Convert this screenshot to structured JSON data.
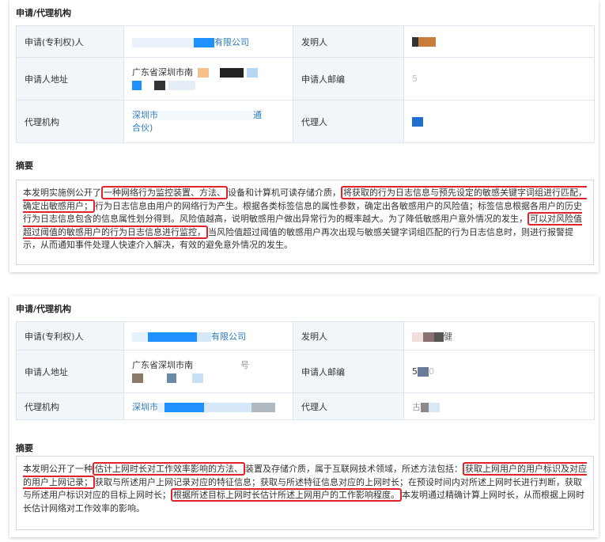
{
  "records": [
    {
      "section_title": "申请/代理机构",
      "rows": [
        {
          "label1": "申请(专利权)人",
          "value1": "有限公司",
          "label2": "发明人"
        },
        {
          "label1": "申请人地址",
          "value1": "广东省深圳市南",
          "label2": "申请人邮编",
          "value2": "5"
        },
        {
          "label1": "代理机构",
          "value1a": "深圳市",
          "value1b": "通",
          "value1c": "合伙)",
          "label2": "代理人"
        }
      ],
      "abstract_title": "摘要",
      "abstract": {
        "t1": "本发明实施例公开了",
        "h1": "一种网络行为监控装置、方法、",
        "t2": "设备和计算机可读存储介质，",
        "h2": "将获取的行为日志信息与预先设定的敏感关键字词组进行匹配，确定出敏感用户；",
        "t3": "行为日志信息由用户的网络行为产生。根据各类标签信息的属性参数，确定出各敏感用户的风险值；标签信息根据各用户的历史行为日志信息包含的信息属性划分得到。风险值越高，说明敏感用户做出异常行为的概率越大。为了降低敏感用户意外情况的发生，",
        "h3": "可以对风险值超过阈值的敏感用户的行为日志信息进行监控，",
        "t4": "当风险值超过阈值的敏感用户再次出现与敏感关键字词组匹配的行为日志信息时，则进行报警提示，从而通知事件处理人快速介入解决，有效的避免意外情况的发生。"
      }
    },
    {
      "section_title": "申请/代理机构",
      "rows": [
        {
          "label1": "申请(专利权)人",
          "value1": "有限公司",
          "label2": "发明人",
          "value2": "健"
        },
        {
          "label1": "申请人地址",
          "value1": "广东省深圳市南",
          "value1b": "号",
          "label2": "申请人邮编",
          "value2": "5",
          "value2b": "0"
        },
        {
          "label1": "代理机构",
          "value1a": "深圳市",
          "label2": "代理人",
          "value2": "古"
        }
      ],
      "abstract_title": "摘要",
      "abstract": {
        "t1": "本发明公开了一种",
        "h1": "估计上网时长对工作效率影响的方法、",
        "t2": "装置及存储介质，属于互联网技术领域，所述方法包括：",
        "h2": "获取上网用户的用户标识及对应的用户上网记录；",
        "t3": "获取与所述用户上网记录对应的特征信息；获取与所述特征信息对应的上网时长；在预设时间内对所述上网时长进行判断，获取与所述用户标识对应的目标上网时长；",
        "h3": "根据所述目标上网时长估计所述上网用户的工作影响程度。",
        "t4": "本发明通过精确计算上网时长，从而根据上网时长估计网络对工作效率的影响。"
      }
    }
  ]
}
